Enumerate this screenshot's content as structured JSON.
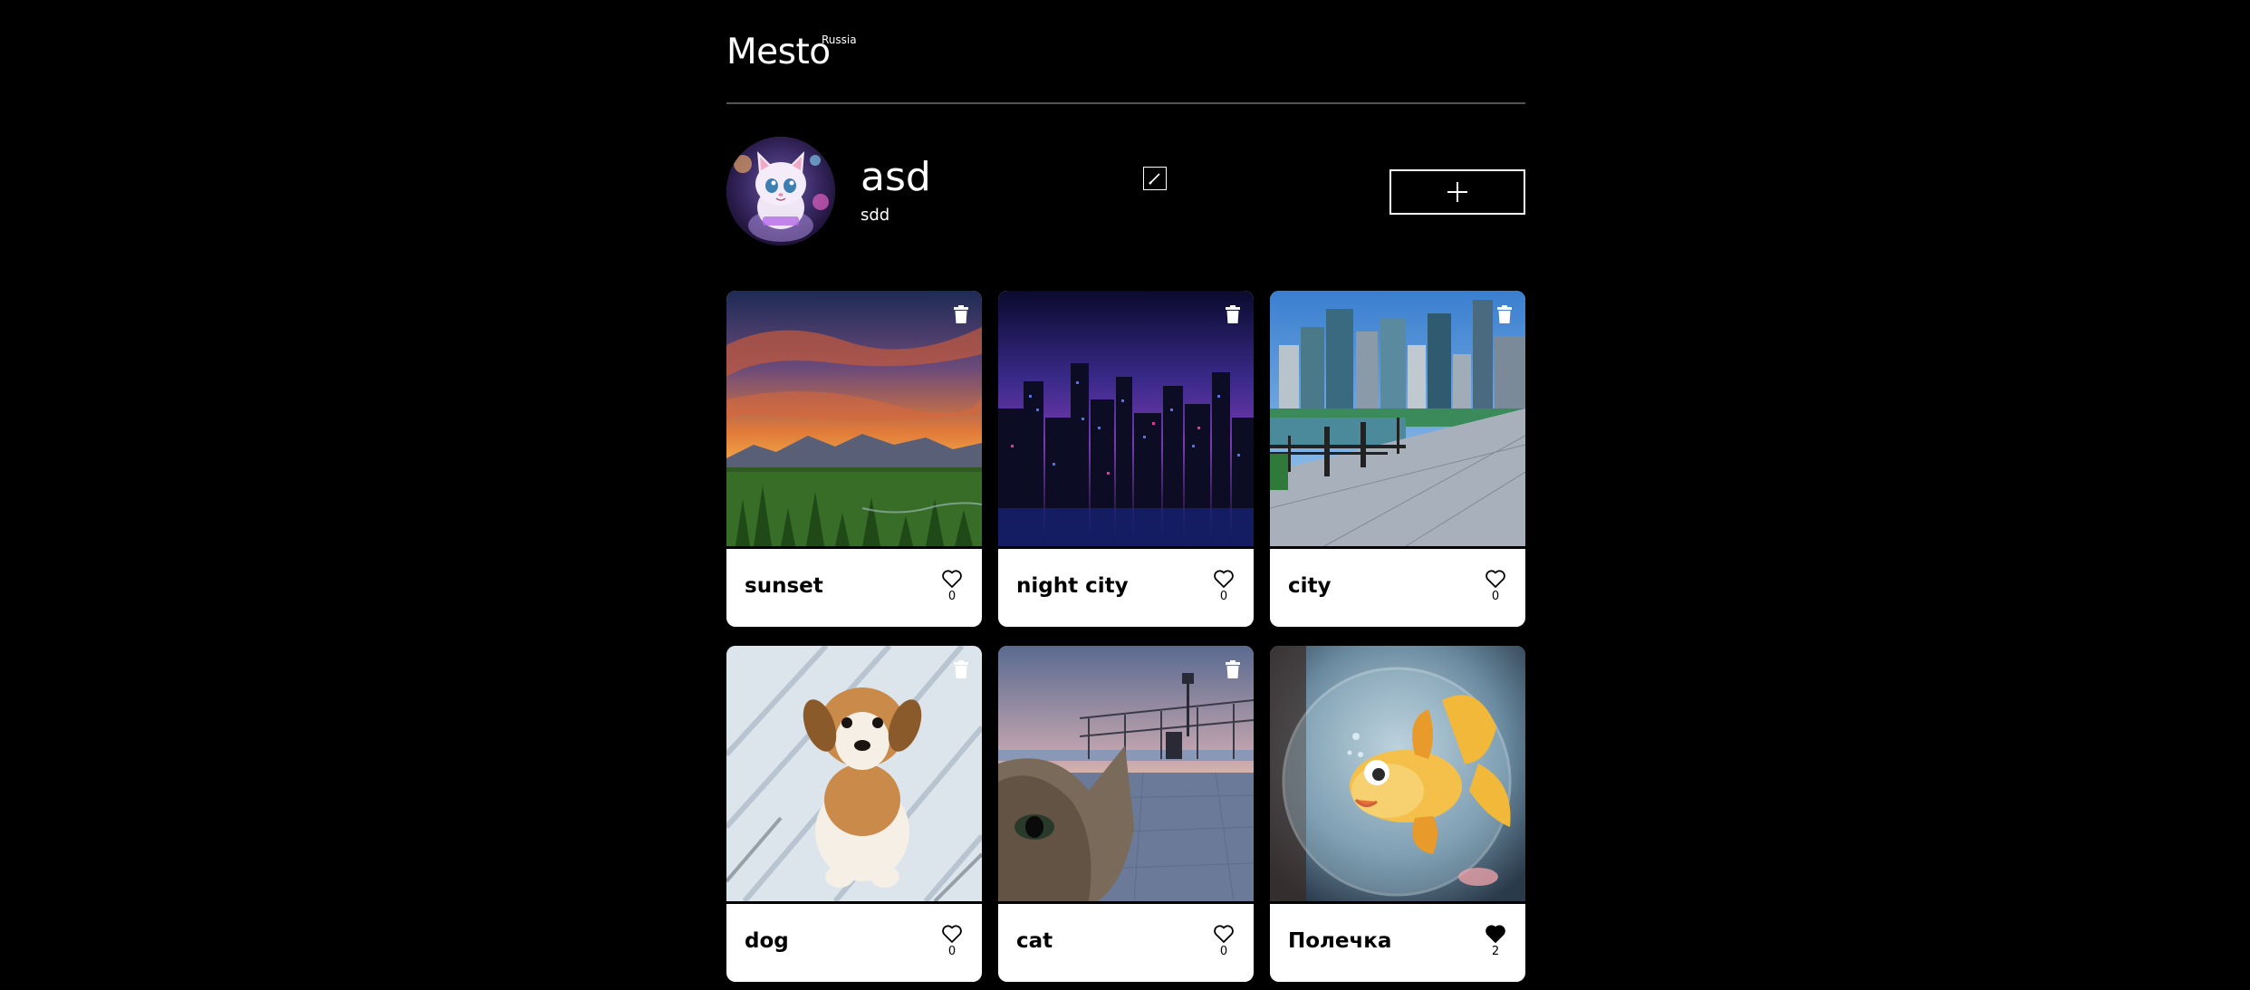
{
  "header": {
    "logo": "Mesto",
    "logo_sup": "Russia"
  },
  "profile": {
    "name": "asd",
    "about": "sdd",
    "edit_icon": "pencil-icon",
    "add_icon": "plus-icon"
  },
  "cards": [
    {
      "title": "sunset",
      "likes": "0",
      "liked": false,
      "deletable": true
    },
    {
      "title": "night city",
      "likes": "0",
      "liked": false,
      "deletable": true
    },
    {
      "title": "city",
      "likes": "0",
      "liked": false,
      "deletable": true
    },
    {
      "title": "dog",
      "likes": "0",
      "liked": false,
      "deletable": true
    },
    {
      "title": "cat",
      "likes": "0",
      "liked": false,
      "deletable": true
    },
    {
      "title": "Полечка",
      "likes": "2",
      "liked": true,
      "deletable": false
    }
  ],
  "colors": {
    "background": "#000000",
    "card": "#ffffff",
    "text_dark": "#000000",
    "divider": "#545454"
  }
}
